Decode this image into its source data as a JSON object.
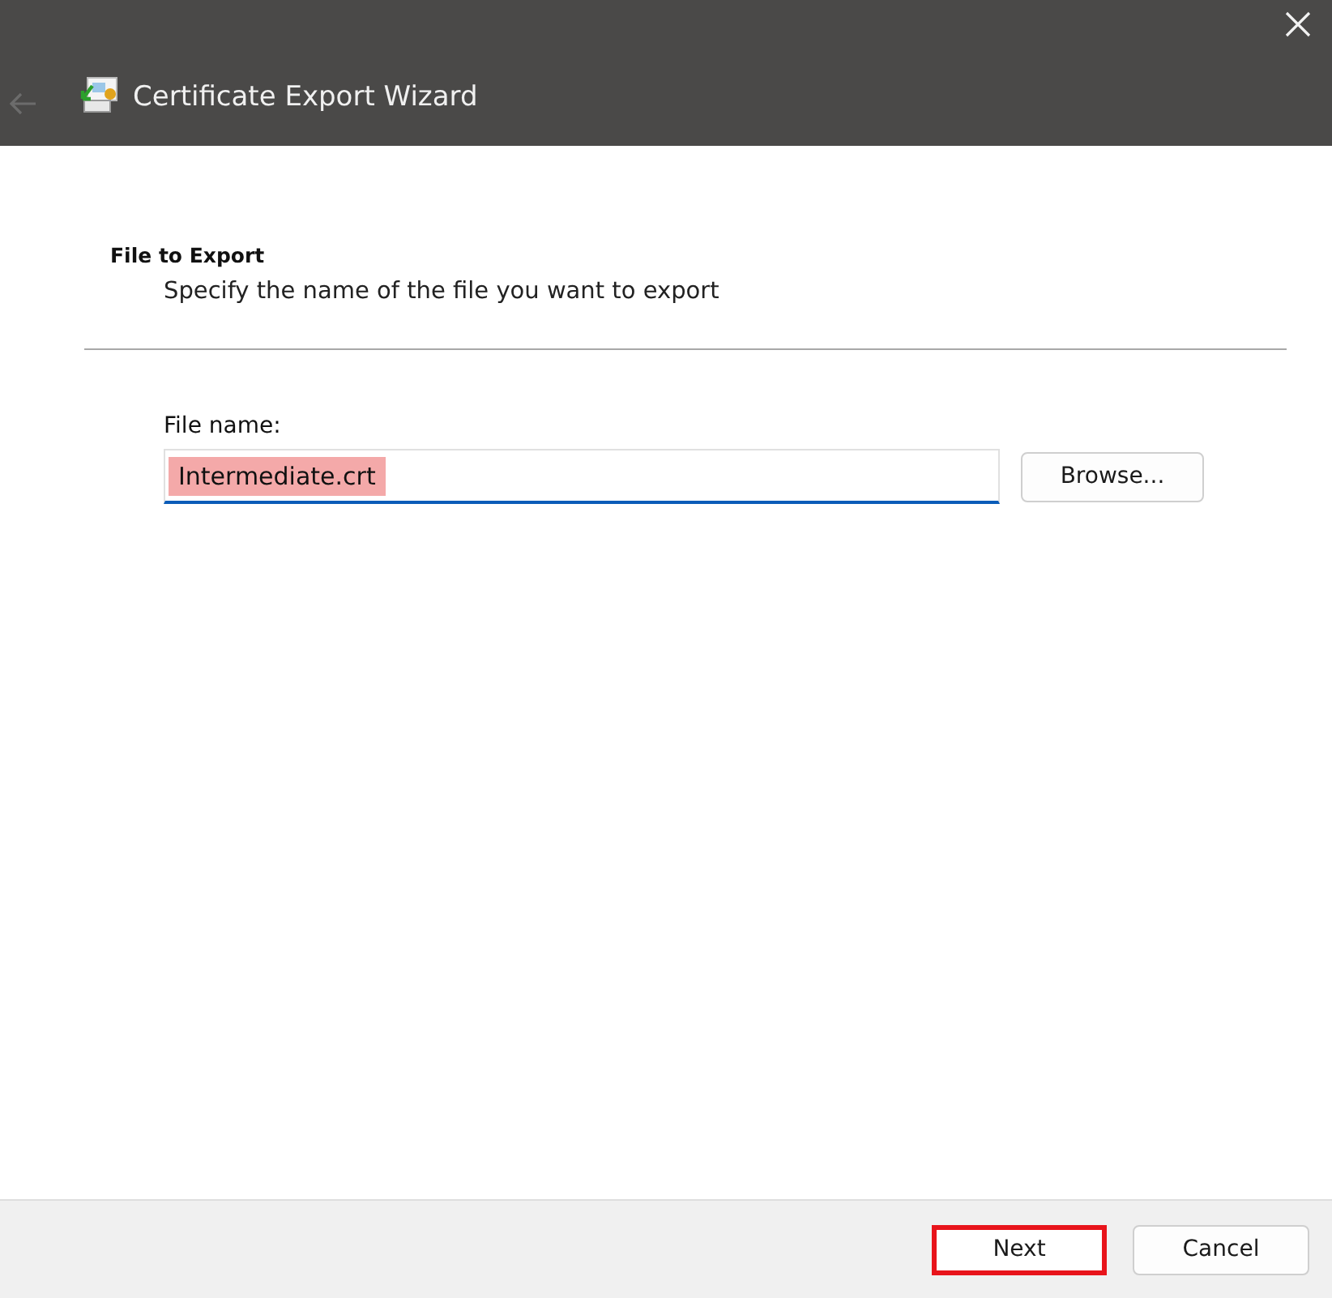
{
  "window": {
    "title": "Certificate Export Wizard",
    "back_enabled": false
  },
  "page": {
    "heading": "File to Export",
    "description": "Specify the name of the file you want to export"
  },
  "file_name": {
    "label": "File name:",
    "value": "Intermediate.crt",
    "value_highlighted": true
  },
  "browse_button": {
    "label": "Browse...",
    "highlighted": false
  },
  "buttons": [
    {
      "label": "Next",
      "highlighted": true
    },
    {
      "label": "Cancel",
      "highlighted": false
    }
  ]
}
